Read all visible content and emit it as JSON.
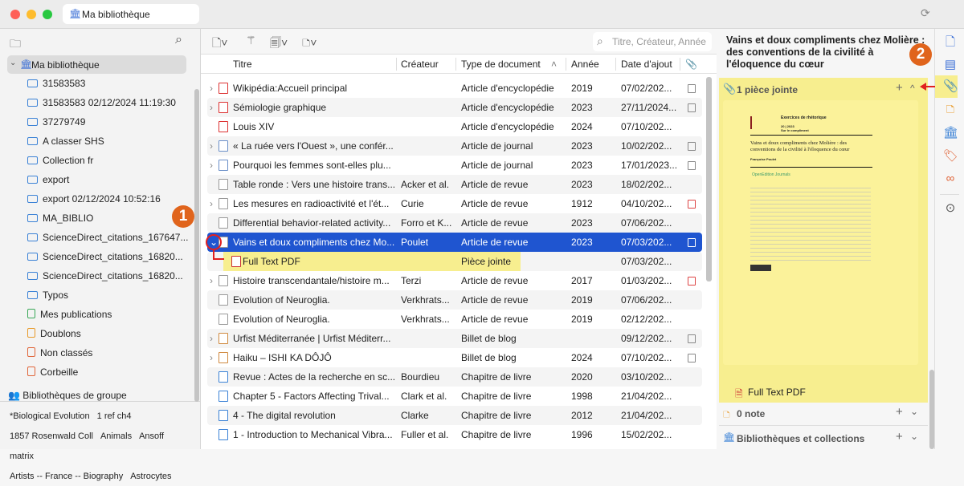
{
  "window": {
    "tab_title": "Ma bibliothèque"
  },
  "sidebar": {
    "library": "Ma bibliothèque",
    "items": [
      "31583583",
      "31583583 02/12/2024 11:19:30",
      "37279749",
      "A classer SHS",
      "Collection fr",
      "export",
      "export 02/12/2024 10:52:16",
      "MA_BIBLIO",
      "ScienceDirect_citations_167647...",
      "ScienceDirect_citations_16820...",
      "ScienceDirect_citations_16820...",
      "Typos"
    ],
    "special": [
      "Mes publications",
      "Doublons",
      "Non classés",
      "Corbeille"
    ],
    "group_libraries": "Bibliothèques de groupe",
    "tags": [
      [
        "*Biological Evolution",
        "1 ref ch4"
      ],
      [
        "1857 Rosenwald Coll",
        "Animals",
        "Ansoff matrix"
      ],
      [
        "Artists -- France -- Biography",
        "Astrocytes"
      ]
    ]
  },
  "toolbar": {
    "search_placeholder": "Titre, Créateur, Année"
  },
  "columns": {
    "title": "Titre",
    "creator": "Créateur",
    "type": "Type de document",
    "year": "Année",
    "date": "Date d'ajout"
  },
  "rows": [
    {
      "t": "Wikipédia:Accueil principal",
      "c": "",
      "ty": "Article d'encyclopédie",
      "y": "2019",
      "d": "07/02/202...",
      "exp": ">",
      "icon": "encyclopedia",
      "att": "snapshot"
    },
    {
      "t": "Sémiologie graphique",
      "c": "",
      "ty": "Article d'encyclopédie",
      "y": "2023",
      "d": "27/11/2024...",
      "exp": ">",
      "icon": "encyclopedia",
      "att": "snapshot"
    },
    {
      "t": "Louis XIV",
      "c": "",
      "ty": "Article d'encyclopédie",
      "y": "2024",
      "d": "07/10/202...",
      "exp": "",
      "icon": "encyclopedia",
      "att": ""
    },
    {
      "t": "« La ruée vers l'Ouest », une confér...",
      "c": "",
      "ty": "Article de journal",
      "y": "2023",
      "d": "10/02/202...",
      "exp": ">",
      "icon": "newspaper",
      "att": "snapshot"
    },
    {
      "t": "Pourquoi les femmes sont-elles plu...",
      "c": "",
      "ty": "Article de journal",
      "y": "2023",
      "d": "17/01/2023...",
      "exp": ">",
      "icon": "newspaper",
      "att": "snapshot"
    },
    {
      "t": "Table ronde : Vers une histoire trans...",
      "c": "Acker et al.",
      "ty": "Article de revue",
      "y": "2023",
      "d": "18/02/202...",
      "exp": "",
      "icon": "article",
      "att": ""
    },
    {
      "t": "Les mesures en radioactivité et l'ét...",
      "c": "Curie",
      "ty": "Article de revue",
      "y": "1912",
      "d": "04/10/202...",
      "exp": ">",
      "icon": "article",
      "att": "pdf"
    },
    {
      "t": "Differential behavior-related activity...",
      "c": "Forro et K...",
      "ty": "Article de revue",
      "y": "2023",
      "d": "07/06/202...",
      "exp": "",
      "icon": "article",
      "att": ""
    },
    {
      "t": "Vains et doux compliments chez Mo...",
      "c": "Poulet",
      "ty": "Article de revue",
      "y": "2023",
      "d": "07/03/202...",
      "exp": "v",
      "icon": "article",
      "att": "pdf",
      "sel": true
    },
    {
      "t": "Full Text PDF",
      "c": "",
      "ty": "Pièce jointe",
      "y": "",
      "d": "07/03/202...",
      "exp": "",
      "icon": "pdf",
      "att": "",
      "child": true
    },
    {
      "t": "Histoire transcendantale/histoire m...",
      "c": "Terzi",
      "ty": "Article de revue",
      "y": "2017",
      "d": "01/03/202...",
      "exp": ">",
      "icon": "article",
      "att": "pdf"
    },
    {
      "t": "Evolution of Neuroglia.",
      "c": "Verkhrats...",
      "ty": "Article de revue",
      "y": "2019",
      "d": "07/06/202...",
      "exp": "",
      "icon": "article",
      "att": ""
    },
    {
      "t": "Evolution of Neuroglia.",
      "c": "Verkhrats...",
      "ty": "Article de revue",
      "y": "2019",
      "d": "02/12/202...",
      "exp": "",
      "icon": "article",
      "att": ""
    },
    {
      "t": "Urfist Méditerranée | Urfist Méditerr...",
      "c": "",
      "ty": "Billet de blog",
      "y": "",
      "d": "09/12/202...",
      "exp": ">",
      "icon": "blog",
      "att": "snapshot"
    },
    {
      "t": "Haiku – ISHI KA DÔJÔ",
      "c": "",
      "ty": "Billet de blog",
      "y": "2024",
      "d": "07/10/202...",
      "exp": ">",
      "icon": "blog",
      "att": "snapshot"
    },
    {
      "t": "Revue : Actes de la recherche en sc...",
      "c": "Bourdieu",
      "ty": "Chapitre de livre",
      "y": "2020",
      "d": "03/10/202...",
      "exp": "",
      "icon": "book",
      "att": ""
    },
    {
      "t": "Chapter 5 - Factors Affecting Trival...",
      "c": "Clark et al.",
      "ty": "Chapitre de livre",
      "y": "1998",
      "d": "21/04/202...",
      "exp": "",
      "icon": "book",
      "att": ""
    },
    {
      "t": "4 - The digital revolution",
      "c": "Clarke",
      "ty": "Chapitre de livre",
      "y": "2012",
      "d": "21/04/202...",
      "exp": "",
      "icon": "book",
      "att": ""
    },
    {
      "t": "1 - Introduction to Mechanical Vibra...",
      "c": "Fuller et al.",
      "ty": "Chapitre de livre",
      "y": "1996",
      "d": "15/02/202...",
      "exp": "",
      "icon": "book",
      "att": ""
    }
  ],
  "details": {
    "title": "Vains et doux compliments chez Molière : des conventions de la civilité à l'éloquence du cœur",
    "attachments_header": "1 pièce jointe",
    "attachment_name": "Full Text PDF",
    "preview": {
      "journal": "Exercices de rhétorique",
      "issue": "20 | 2023",
      "issue_title": "Sur le compliment",
      "doc_title": "Vains et doux compliments chez Molière : des conventions de la civilité à l'éloquence du cœur",
      "author": "Françoise Poulet",
      "publisher": "OpenEdition Journals"
    },
    "notes_header": "0 note",
    "libraries_header": "Bibliothèques et collections"
  },
  "annotations": {
    "badge1": "1",
    "badge2": "2"
  },
  "colors": {
    "selection": "#1f55d0",
    "highlight": "#f7ee8f",
    "badge": "#e0641c",
    "arrow": "#e02020"
  }
}
